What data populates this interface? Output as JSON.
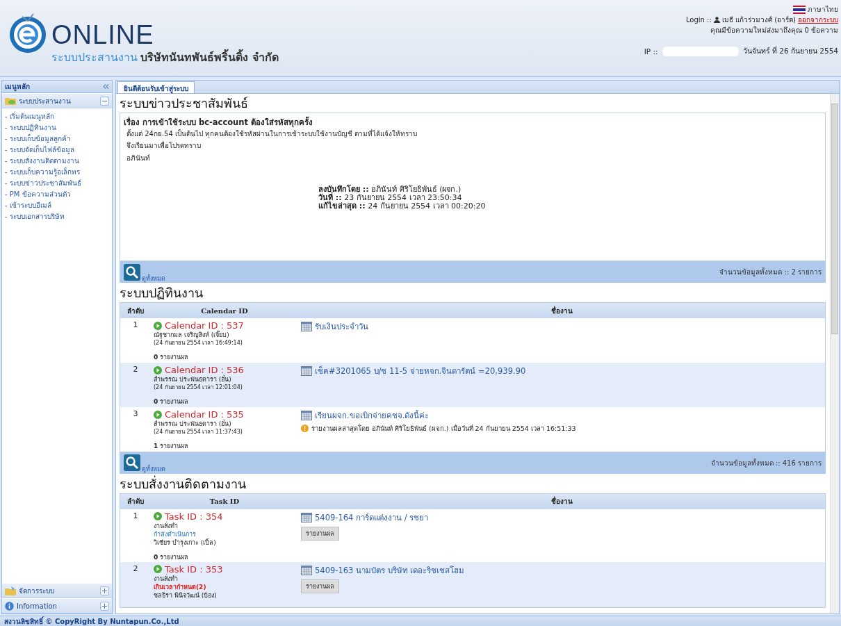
{
  "header": {
    "logo": "ONLINE",
    "subtitle": "ระบบประสานงาน",
    "company": "บริษัทนันทพันธ์พริ้นติ้ง จำกัด",
    "language": "ภาษาไทย",
    "login_label": "Login ::",
    "user": "เมธี แก้วร่วมวงศ์ (อาร์ต)",
    "logout": "ออกจากระบบ",
    "message": "คุณมีข้อความใหม่ส่งมาถึงคุณ 0 ข้อความ",
    "ip_label": "IP ::",
    "date": "วันจันทร์ ที่ 26 กันยายน 2554"
  },
  "sidebar": {
    "title": "เมนูหลัก",
    "sections": [
      {
        "label": "ระบบประสานงาน",
        "expanded": true,
        "items": [
          "- เริ่มต้นเมนูหลัก",
          "- ระบบปฏิทินงาน",
          "- ระบบเก็บข้อมูลลูกค้า",
          "- ระบบจัดเก็บไฟล์ข้อมูล",
          "- ระบบสั่งงานติดตามงาน",
          "- ระบบเก็บความรู้อเล็กทร",
          "- ระบบข่าวประชาสัมพันธ์",
          "- PM ข้อความส่วนตัว",
          "- เข้าระบบอีเมล์",
          "- ระบบเอกสารบริษัท"
        ]
      },
      {
        "label": "จัดการระบบ",
        "expanded": false
      },
      {
        "label": "Information",
        "expanded": false
      }
    ]
  },
  "tabs": [
    {
      "label": "ยินดีต้อนรับเข้าสู่ระบบ",
      "selected": true
    }
  ],
  "news": {
    "title": "ระบบข่าวประชาสัมพันธ์",
    "subject": "เรื่อง การเข้าใช้ระบบ bc-account ต้องใส่รหัสทุกครั้ง",
    "body": [
      "ตั้งแต่ 24กย.54 เป็นต้นไป ทุกคนต้องใช้รหัสผ่านในการเข้าระบบใช้งานบัญชี ตามที่ได้แจ้งให้ทราบ",
      "จึงเรียนมาเพื่อโปรดทราบ",
      "อภินันท์"
    ],
    "meta": [
      "**ลงบันทึกโดย ::** อภินันท์ ศิริโยธิพันธ์ (ผจก.)",
      "**วันที่ ::** 23 กันยายน 2554 เวลา 23:50:34",
      "**แก้ไขล่าสุด ::** 24 กันยายน 2554 เวลา 00:20:20"
    ],
    "view_all": "ดูทั้งหมด",
    "total": "จำนวนข้อมูลทั้งหมด :: 2 รายการ"
  },
  "calendar": {
    "title": "ระบบปฏิทินงาน",
    "columns": [
      "ลำดับ",
      "Calendar ID",
      "ชื่องาน"
    ],
    "rows": [
      {
        "no": "1",
        "id": "Calendar ID : 537",
        "person": "ณัฐชากมล เจริญสิงห์ (เจี๊ยบ)",
        "time": "(24 กันยายน 2554 เวลา 16:49:14)",
        "reports": "**0** รายงานผล",
        "job": "รับเงินประจำวัน"
      },
      {
        "no": "2",
        "id": "Calendar ID : 536",
        "person": "สำพรรณ ประพันธดารา (อั๋น)",
        "time": "(24 กันยายน 2554 เวลา 12:01:04)",
        "reports": "**0** รายงานผล",
        "job": "เช็ค#3201065 บ/ช 11-5 จ่ายหจก.จินดารัตน์ =20,939.90"
      },
      {
        "no": "3",
        "id": "Calendar ID : 535",
        "person": "สำพรรณ ประพันธดารา (อั๋น)",
        "time": "(24 กันยายน 2554 เวลา 11:37:43)",
        "reports": "**1** รายงานผล",
        "job": "เรียนผจก.ขอเบิกจ่ายคชจ.ดังนี้ค่ะ",
        "note": "รายงานผลล่าสุดโดย อภินันท์ ศิริโยธิพันธ์ (ผจก.) เมื่อวันที่ 24 กันยายน 2554 เวลา 16:51:33"
      }
    ],
    "view_all": "ดูทั้งหมด",
    "total": "จำนวนข้อมูลทั้งหมด :: 416 รายการ"
  },
  "tasks": {
    "title": "ระบบสั่งงานติดตามงาน",
    "columns": [
      "ลำดับ",
      "Task ID",
      "ชื่องาน"
    ],
    "rows": [
      {
        "no": "1",
        "id": "Task ID : 354",
        "type": "งานสั่งทำ",
        "status": "กำลังดำเนินการ",
        "kind": "progress",
        "person": "วิเชียร บำรุงเกาะ (เปิ้ล)",
        "reports": "**0** รายงานผล",
        "job": "5409-164 การ์ดแต่งงาน / รชยา",
        "button": "รายงานผล"
      },
      {
        "no": "2",
        "id": "Task ID : 353",
        "type": "งานสั่งทำ",
        "status": "เกินเวลากำหนด(2)",
        "kind": "overdue",
        "person": "ชลธิรา พินิจวัฒน์ (ป้อง)",
        "job": "5409-163 นามบัตร บริษัท เดอะริชเชสโฮม",
        "button": "รายงานผล"
      }
    ]
  },
  "footer": "สงวนลิขสิทธิ์ © CopyRight By Nuntapun.Co.,Ltd"
}
